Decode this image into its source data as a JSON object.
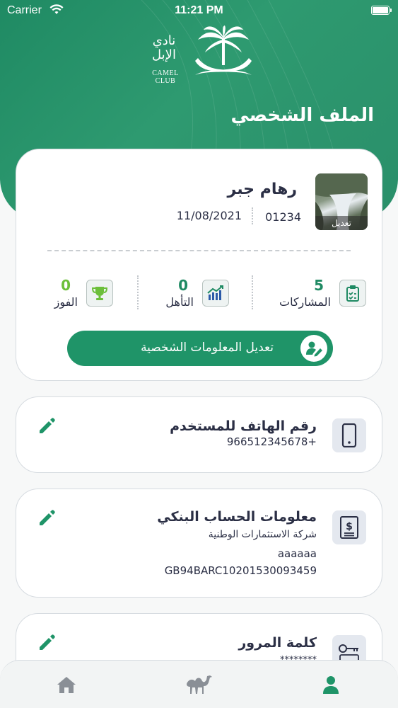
{
  "status_bar": {
    "carrier": "Carrier",
    "time": "11:21 PM"
  },
  "logo": {
    "arabic_line1": "نادي",
    "arabic_line2": "الإبل",
    "english": "CAMEL CLUB"
  },
  "page_title": "الملف الشخصي",
  "profile": {
    "name": "رهام جبر",
    "id": "01234",
    "date": "11/08/2021",
    "avatar_edit_label": "تعديل",
    "stats": [
      {
        "value": "5",
        "label": "المشاركات",
        "icon": "clipboard-check-icon"
      },
      {
        "value": "0",
        "label": "التأهل",
        "icon": "bar-chart-up-icon"
      },
      {
        "value": "0",
        "label": "الفوز",
        "icon": "trophy-icon"
      }
    ],
    "edit_button_label": "تعديل المعلومات الشخصية"
  },
  "phone_card": {
    "title": "رقم الهاتف للمستخدم",
    "value": "+966512345678"
  },
  "bank_card": {
    "title": "معلومات الحساب البنكي",
    "bank_name": "شركة الاستثمارات الوطنية",
    "holder": "aaaaaa",
    "iban": "GB94BARC10201530093459"
  },
  "password_card": {
    "title": "كلمة المرور",
    "value": "********"
  },
  "bottom_nav": {
    "items": [
      {
        "icon": "home-icon",
        "active": false
      },
      {
        "icon": "camel-icon",
        "active": false
      },
      {
        "icon": "user-icon",
        "active": true
      }
    ]
  },
  "colors": {
    "brand_green": "#1f9468",
    "stat_green": "#1f8a63",
    "text_dark": "#2b2f45",
    "icon_tile": "#e4e8ef"
  }
}
